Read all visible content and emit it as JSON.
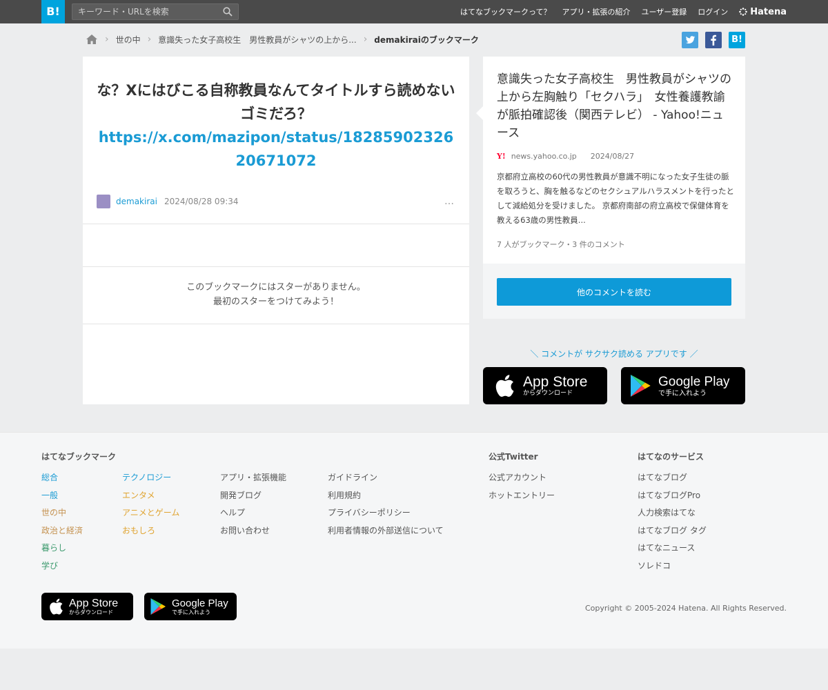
{
  "topbar": {
    "logo": "B!",
    "search_placeholder": "キーワード・URLを検索",
    "nav": [
      "はてなブックマークって？",
      "アプリ・拡張の紹介",
      "ユーザー登録",
      "ログイン"
    ],
    "hatena_logo": "Hatena"
  },
  "breadcrumb": {
    "items": [
      "世の中",
      "意識失った女子高校生　男性教員がシャツの上から...",
      "demakiraiのブックマーク"
    ]
  },
  "share": {
    "hatena": "B!"
  },
  "bookmark": {
    "comment_text": "な？Xにはびこる自称教員なんてタイトルすら読めないゴミだろ？",
    "comment_link": "https://x.com/mazipon/status/1828590232620671072",
    "user": "demakirai",
    "datetime": "2024/08/28 09:34",
    "more": "…",
    "stars_line1": "このブックマークにはスターがありません。",
    "stars_line2": "最初のスターをつけてみよう！"
  },
  "entry": {
    "title": "意識失った女子高校生　男性教員がシャツの上から左胸触り「セクハラ」　女性養護教諭が脈拍確認後（関西テレビ） - Yahoo!ニュース",
    "source_icon": "Y!",
    "domain": "news.yahoo.co.jp",
    "date": "2024/08/27",
    "excerpt": "京都府立高校の60代の男性教員が意識不明になった女子生徒の脈を取ろうと、胸を触るなどのセクシュアルハラスメントを行ったとして減給処分を受けました。 京都府南部の府立高校で保健体育を教える63歳の男性教員...",
    "counts": "7 人がブックマーク・3 件のコメント",
    "more_button": "他のコメントを読む"
  },
  "app_promo": {
    "tagline": "＼ コメントが サクサク読める アプリです ／",
    "appstore_big": "App Store",
    "appstore_small": "からダウンロード",
    "googleplay_big": "Google Play",
    "googleplay_small": "で手に入れよう"
  },
  "footer": {
    "heading_bookmark": "はてなブックマーク",
    "heading_twitter": "公式Twitter",
    "heading_services": "はてなのサービス",
    "col1": [
      "総合",
      "一般",
      "世の中",
      "政治と経済",
      "暮らし",
      "学び"
    ],
    "col2": [
      "テクノロジー",
      "エンタメ",
      "アニメとゲーム",
      "おもしろ"
    ],
    "col3": [
      "アプリ・拡張機能",
      "開発ブログ",
      "ヘルプ",
      "お問い合わせ"
    ],
    "col4": [
      "ガイドライン",
      "利用規約",
      "プライバシーポリシー",
      "利用者情報の外部送信について"
    ],
    "twitter": [
      "公式アカウント",
      "ホットエントリー"
    ],
    "services": [
      "はてなブログ",
      "はてなブログPro",
      "人力検索はてな",
      "はてなブログ タグ",
      "はてなニュース",
      "ソレドコ"
    ],
    "copyright": "Copyright © 2005-2024 Hatena. All Rights Reserved."
  }
}
